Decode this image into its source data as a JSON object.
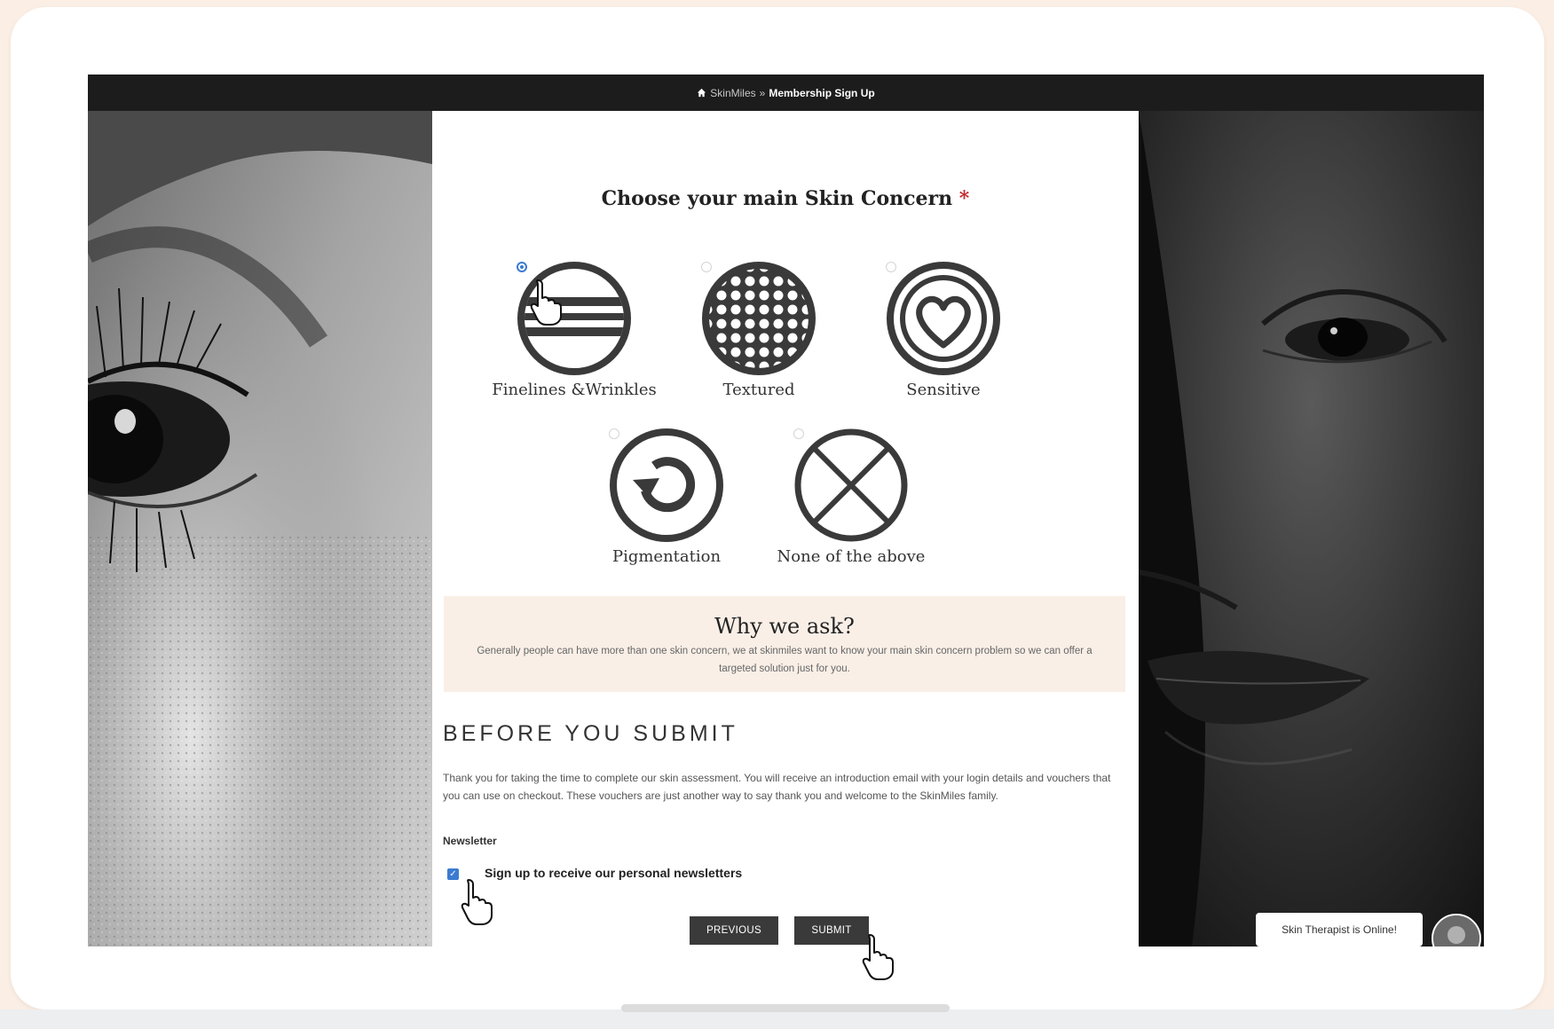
{
  "breadcrumb": {
    "home": "SkinMiles",
    "separator": "»",
    "current": "Membership Sign Up"
  },
  "question": {
    "title": "Choose your main Skin Concern",
    "required_mark": "*"
  },
  "options": [
    {
      "label": "Finelines &Wrinkles",
      "icon": "finelines-icon",
      "selected": true
    },
    {
      "label": "Textured",
      "icon": "textured-icon",
      "selected": false
    },
    {
      "label": "Sensitive",
      "icon": "heart-icon",
      "selected": false
    },
    {
      "label": "Pigmentation",
      "icon": "refresh-icon",
      "selected": false
    },
    {
      "label": "None of the above",
      "icon": "cross-icon",
      "selected": false
    }
  ],
  "why": {
    "title": "Why we ask?",
    "text": "Generally people can have more than one skin concern, we at skinmiles want to know your main skin concern problem so we can offer a targeted solution just for you."
  },
  "before": {
    "title": "BEFORE YOU SUBMIT",
    "text": "Thank you for taking the time to complete our skin assessment. You will receive an introduction email with your login details and vouchers that you can use on checkout. These vouchers are just another way to say thank you and welcome to the SkinMiles family."
  },
  "newsletter": {
    "label": "Newsletter",
    "checkbox_label": "Sign up to receive our personal newsletters",
    "checked": true
  },
  "buttons": {
    "previous": "PREVIOUS",
    "submit": "SUBMIT"
  },
  "chat": {
    "status": "Skin Therapist is Online!"
  },
  "colors": {
    "accent": "#3b7bd0",
    "topbar": "#1c1c1c",
    "why_bg": "#f9efe7",
    "button": "#3a3a3a",
    "required": "#c0282a"
  }
}
